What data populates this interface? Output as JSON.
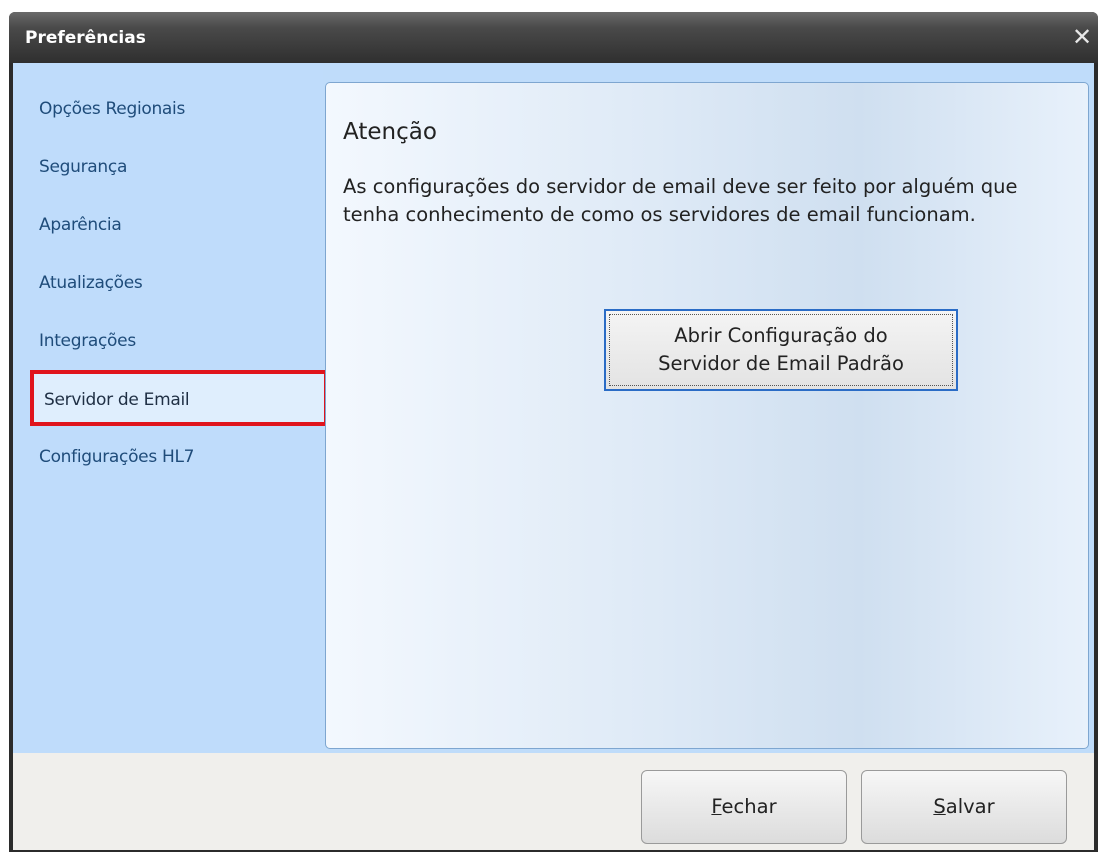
{
  "window": {
    "title": "Preferências",
    "close_glyph": "✕"
  },
  "sidebar": {
    "items": [
      {
        "label": "Opções Regionais"
      },
      {
        "label": "Segurança"
      },
      {
        "label": "Aparência"
      },
      {
        "label": "Atualizações"
      },
      {
        "label": "Integrações"
      },
      {
        "label": "Servidor de Email",
        "selected": true
      },
      {
        "label": "Configurações HL7"
      }
    ]
  },
  "content": {
    "title": "Atenção",
    "message": "As configurações do servidor de email deve ser feito por alguém que tenha conhecimento de como os servidores de email funcionam.",
    "open_config_button": "Abrir Configuração do\nServidor de Email Padrão"
  },
  "footer": {
    "close_button": {
      "mnemonic": "F",
      "rest": "echar"
    },
    "save_button": {
      "mnemonic": "S",
      "rest": "alvar"
    }
  },
  "colors": {
    "sidebar_bg": "#bfdcfb",
    "selection_outline": "#e0141c",
    "title_bar": "#2f2f2f",
    "button_focus_border": "#2a6cc6"
  }
}
